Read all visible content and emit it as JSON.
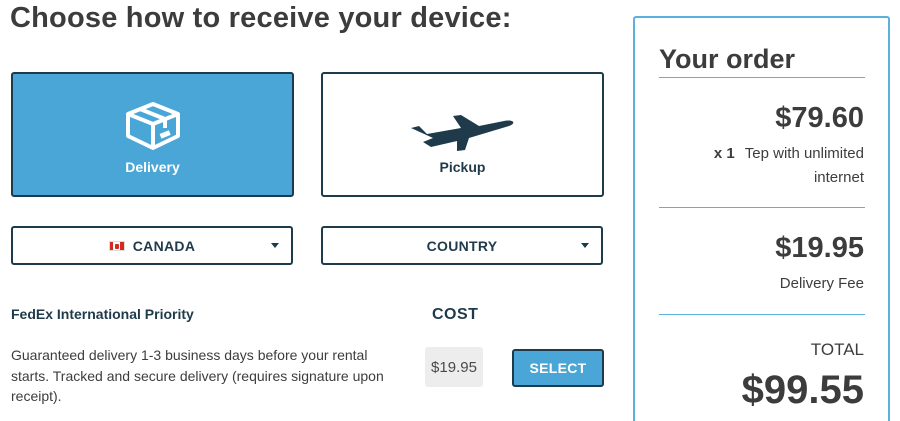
{
  "heading": "Choose how to receive your device:",
  "options": {
    "delivery": {
      "label": "Delivery",
      "icon": "package-icon"
    },
    "pickup": {
      "label": "Pickup",
      "icon": "airplane-icon"
    }
  },
  "dropdowns": {
    "country_selected": "CANADA",
    "second_selected": "COUNTRY"
  },
  "shipping": {
    "carrier": "FedEx International Priority",
    "cost_header": "COST",
    "description": "Guaranteed delivery 1-3 business days before your rental starts. Tracked and secure delivery (requires signature upon receipt).",
    "price": "$19.95",
    "select_label": "SELECT"
  },
  "order": {
    "title": "Your order",
    "item_price": "$79.60",
    "item_qty": "x 1",
    "item_name": "Tep with unlimited internet",
    "fee_price": "$19.95",
    "fee_label": "Delivery Fee",
    "total_label": "TOTAL",
    "total_price": "$99.55"
  },
  "colors": {
    "accent": "#4aa6d6",
    "dark": "#1d3b4a",
    "border_blue": "#5bb0de"
  }
}
